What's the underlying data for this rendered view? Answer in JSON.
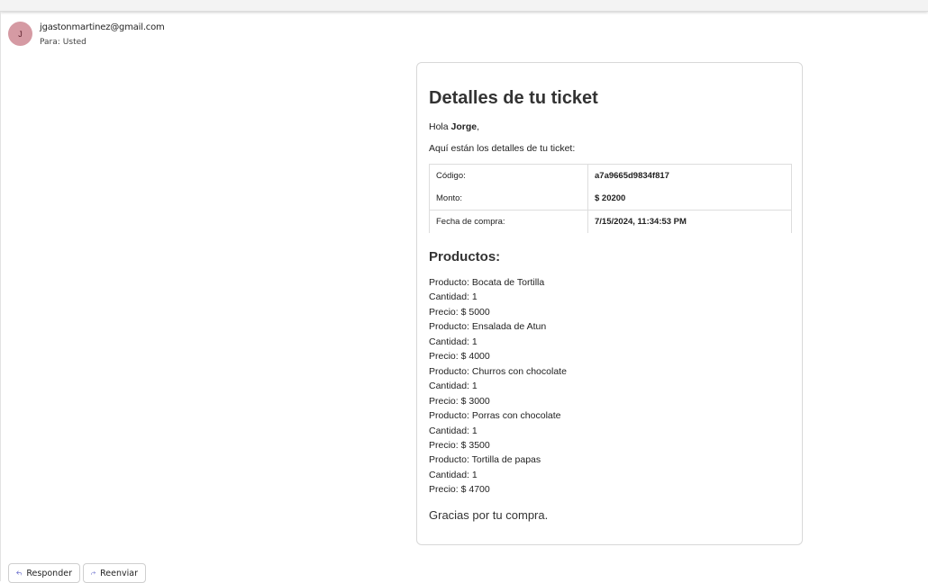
{
  "email": {
    "avatar_initial": "J",
    "sender": "jgastonmartinez@gmail.com",
    "to_label": "Para:",
    "to_value": "Usted"
  },
  "ticket": {
    "title": "Detalles de tu ticket",
    "greeting_prefix": "Hola ",
    "greeting_name": "Jorge",
    "greeting_suffix": ",",
    "intro": "Aquí están los detalles de tu ticket:",
    "details": [
      {
        "label": "Código:",
        "value": "a7a9665d9834f817"
      },
      {
        "label": "Monto:",
        "value": "$ 20200"
      },
      {
        "label": "Fecha de compra:",
        "value": "7/15/2024, 11:34:53 PM"
      }
    ],
    "products_heading": "Productos:",
    "products": [
      {
        "name": "Producto: Bocata de Tortilla",
        "qty": "Cantidad: 1",
        "price": "Precio: $ 5000"
      },
      {
        "name": "Producto: Ensalada de Atun",
        "qty": "Cantidad: 1",
        "price": "Precio: $ 4000"
      },
      {
        "name": "Producto: Churros con chocolate",
        "qty": "Cantidad: 1",
        "price": "Precio: $ 3000"
      },
      {
        "name": "Producto: Porras con chocolate",
        "qty": "Cantidad: 1",
        "price": "Precio: $ 3500"
      },
      {
        "name": "Producto: Tortilla de papas",
        "qty": "Cantidad: 1",
        "price": "Precio: $ 4700"
      }
    ],
    "thanks": "Gracias por tu compra."
  },
  "actions": {
    "reply_label": "Responder",
    "forward_label": "Reenviar",
    "reply_icon": "reply-arrow-icon",
    "forward_icon": "forward-arrow-icon",
    "icon_color": "#5b5fc7"
  },
  "colors": {
    "avatar_bg": "#d59aa3",
    "border": "#d8d8d8"
  }
}
